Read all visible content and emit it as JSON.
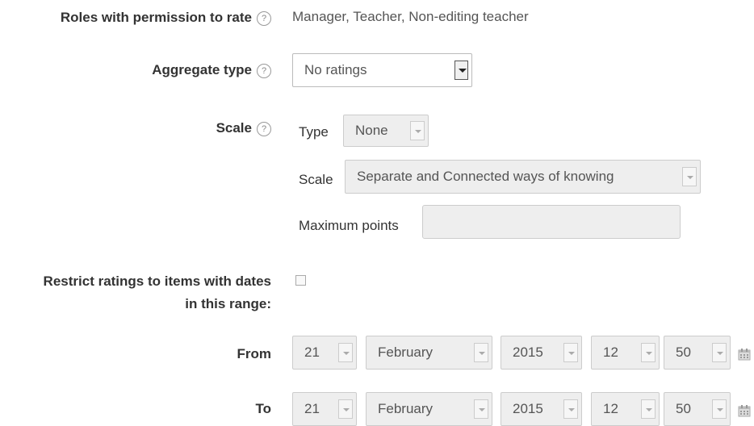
{
  "roles": {
    "label": "Roles with permission to rate",
    "value": "Manager, Teacher, Non-editing teacher"
  },
  "aggregate": {
    "label": "Aggregate type",
    "selected": "No ratings"
  },
  "scale": {
    "label": "Scale",
    "type_label": "Type",
    "type_selected": "None",
    "scale_label": "Scale",
    "scale_selected": "Separate and Connected ways of knowing",
    "max_points_label": "Maximum points",
    "max_points_value": ""
  },
  "restrict": {
    "label_line1": "Restrict ratings to items with dates",
    "label_line2": "in this range:",
    "checked": false
  },
  "from": {
    "label": "From",
    "day": "21",
    "month": "February",
    "year": "2015",
    "hour": "12",
    "minute": "50"
  },
  "to": {
    "label": "To",
    "day": "21",
    "month": "February",
    "year": "2015",
    "hour": "12",
    "minute": "50"
  },
  "help_glyph": "?",
  "colors": {
    "label": "#333333",
    "disabled_bg": "#eeeeee",
    "border": "#cccccc"
  }
}
